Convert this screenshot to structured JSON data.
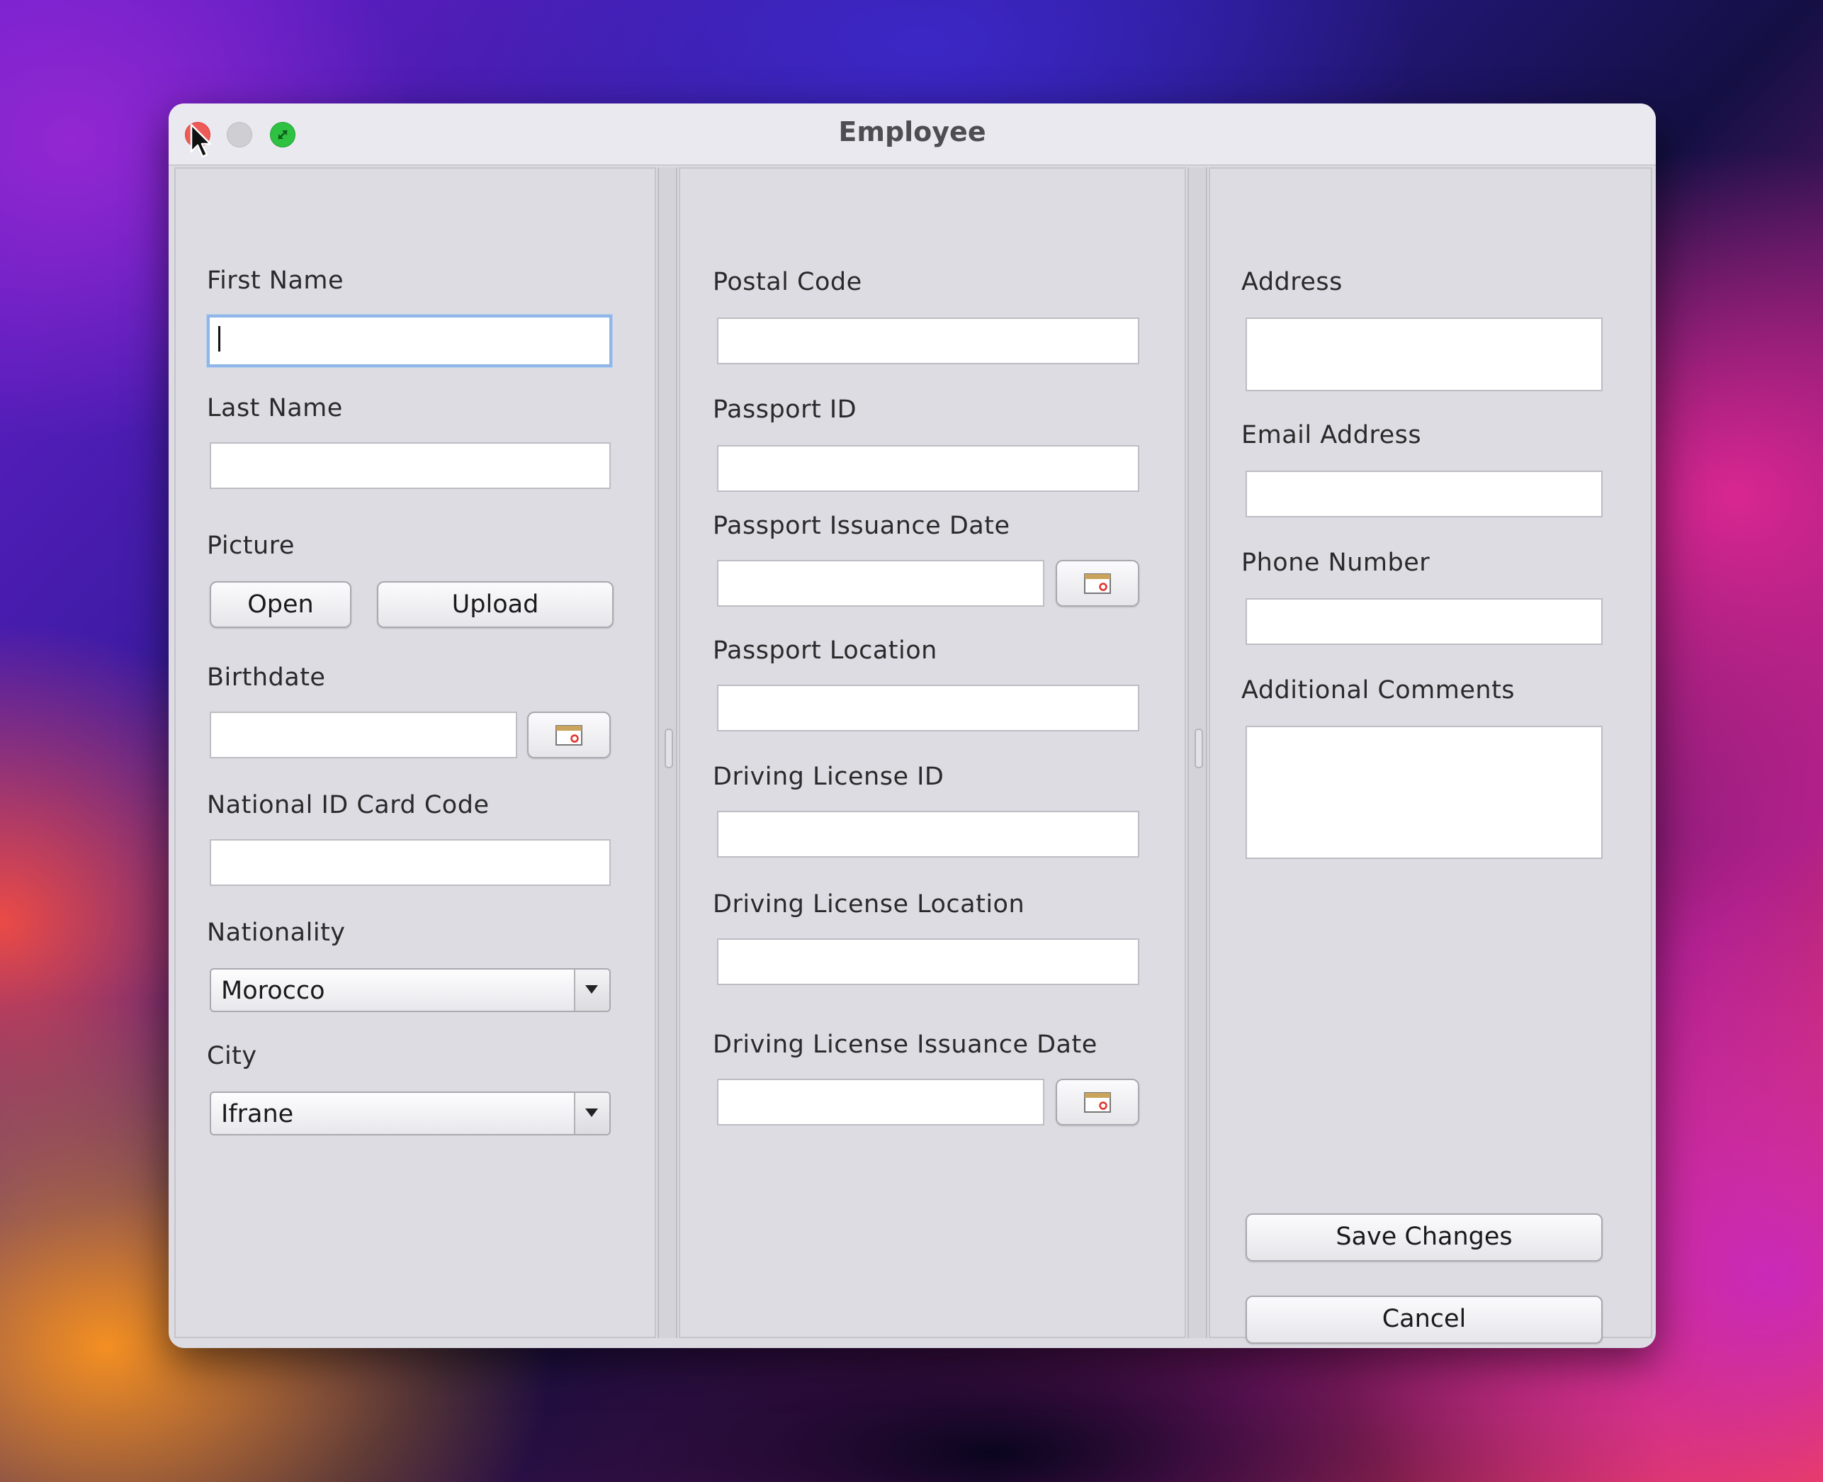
{
  "window": {
    "title": "Employee"
  },
  "left_panel": {
    "first_name": {
      "label": "First Name",
      "value": ""
    },
    "last_name": {
      "label": "Last Name",
      "value": ""
    },
    "picture": {
      "label": "Picture",
      "open_label": "Open",
      "upload_label": "Upload"
    },
    "birthdate": {
      "label": "Birthdate",
      "value": "",
      "icon": "calendar-icon"
    },
    "national_id": {
      "label": "National ID Card Code",
      "value": ""
    },
    "nationality": {
      "label": "Nationality",
      "selected": "Morocco"
    },
    "city": {
      "label": "City",
      "selected": "Ifrane"
    }
  },
  "middle_panel": {
    "postal_code": {
      "label": "Postal Code",
      "value": ""
    },
    "passport_id": {
      "label": "Passport ID",
      "value": ""
    },
    "passport_issuance_date": {
      "label": "Passport Issuance Date",
      "value": "",
      "icon": "calendar-icon"
    },
    "passport_location": {
      "label": "Passport Location",
      "value": ""
    },
    "driving_license_id": {
      "label": "Driving License ID",
      "value": ""
    },
    "driving_license_location": {
      "label": "Driving License Location",
      "value": ""
    },
    "driving_license_issuance_date": {
      "label": "Driving License Issuance Date",
      "value": "",
      "icon": "calendar-icon"
    }
  },
  "right_panel": {
    "address": {
      "label": "Address",
      "value": ""
    },
    "email": {
      "label": "Email Address",
      "value": ""
    },
    "phone": {
      "label": "Phone Number",
      "value": ""
    },
    "comments": {
      "label": "Additional Comments",
      "value": ""
    },
    "save_label": "Save Changes",
    "cancel_label": "Cancel"
  },
  "colors": {
    "close": "#ee5b57",
    "minimize": "#cfcfd3",
    "maximize": "#2fc142",
    "focus_ring": "#8fb6e6",
    "window_bg": "#dcdce2"
  }
}
